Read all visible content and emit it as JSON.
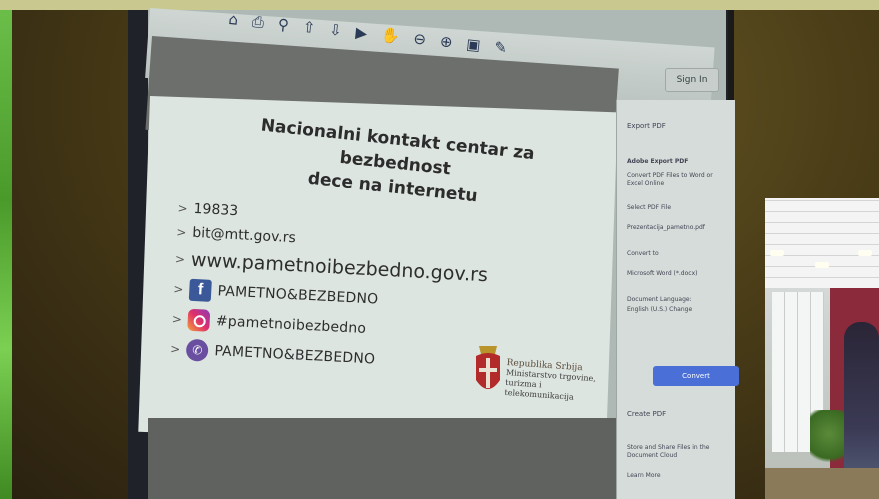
{
  "slide": {
    "title_line1": "Nacionalni kontakt centar za bezbednost",
    "title_line2": "dece na internetu",
    "bullets": [
      {
        "text": "19833"
      },
      {
        "text": "bit@mtt.gov.rs"
      },
      {
        "text": "www.pametnoibezbedno.gov.rs"
      },
      {
        "text": "PAMETNO&BEZBEDNO",
        "icon": "facebook-icon"
      },
      {
        "text": "#pametnoibezbedno",
        "icon": "instagram-icon"
      },
      {
        "text": "PAMETNO&BEZBEDNO",
        "icon": "viber-icon"
      }
    ],
    "crest": {
      "line1": "Republika Srbija",
      "line2": "Ministarstvo trgovine, turizma i",
      "line3": "telekomunikacija"
    }
  },
  "toolbar": {
    "signin_label": "Sign In"
  },
  "right_panel": {
    "export_pdf": "Export PDF",
    "export_title": "Adobe Export PDF",
    "convert_desc": "Convert PDF Files to Word or Excel Online",
    "select_file": "Select PDF File",
    "file_name": "Prezentacija_pametno.pdf",
    "convert_to": "Convert to",
    "format": "Microsoft Word (*.docx)",
    "doc_language": "Document Language:",
    "language_value": "English (U.S.) Change",
    "convert_button": "Convert",
    "create_pdf": "Create PDF",
    "store_share": "Store and Share Files in the Document Cloud",
    "learn_more": "Learn More"
  }
}
